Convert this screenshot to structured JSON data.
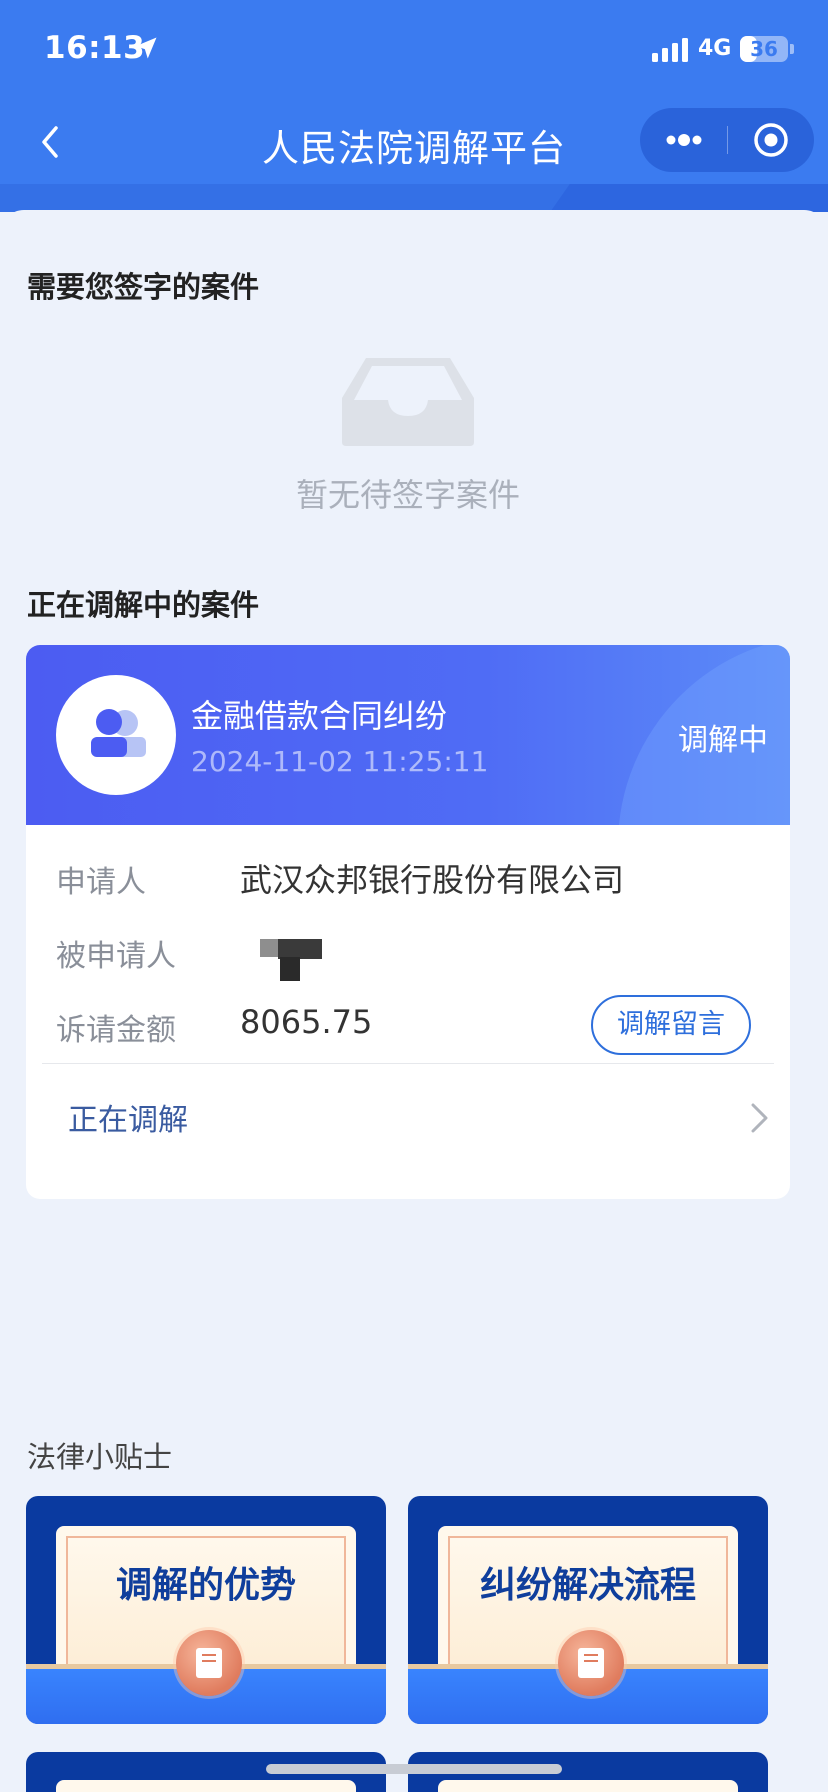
{
  "status_bar": {
    "time": "16:13",
    "network": "4G",
    "battery": "36",
    "battery_level": 0.36
  },
  "nav": {
    "title": "人民法院调解平台",
    "back_icon": "chevron-left-icon",
    "more_icon": "more-dots-icon",
    "close_icon": "target-circle-icon"
  },
  "signing": {
    "title": "需要您签字的案件",
    "empty_text": "暂无待签字案件",
    "empty_icon": "empty-inbox-icon"
  },
  "mediating": {
    "title": "正在调解中的案件",
    "case": {
      "type": "金融借款合同纠纷",
      "datetime": "2024-11-02 11:25:11",
      "status": "调解中",
      "applicant_label": "申请人",
      "applicant": "武汉众邦银行股份有限公司",
      "respondent_label": "被申请人",
      "amount_label": "诉请金额",
      "amount": "8065.75",
      "message_button": "调解留言",
      "progress": "正在调解"
    }
  },
  "tips": {
    "title": "法律小贴士",
    "items": [
      {
        "label": "调解的优势"
      },
      {
        "label": "纠纷解决流程"
      }
    ]
  },
  "colors": {
    "header_blue": "#3b7bf0",
    "card_gradient_start": "#4c5cf2",
    "button_blue": "#2e6fdc",
    "page_bg": "#edf2fb"
  }
}
